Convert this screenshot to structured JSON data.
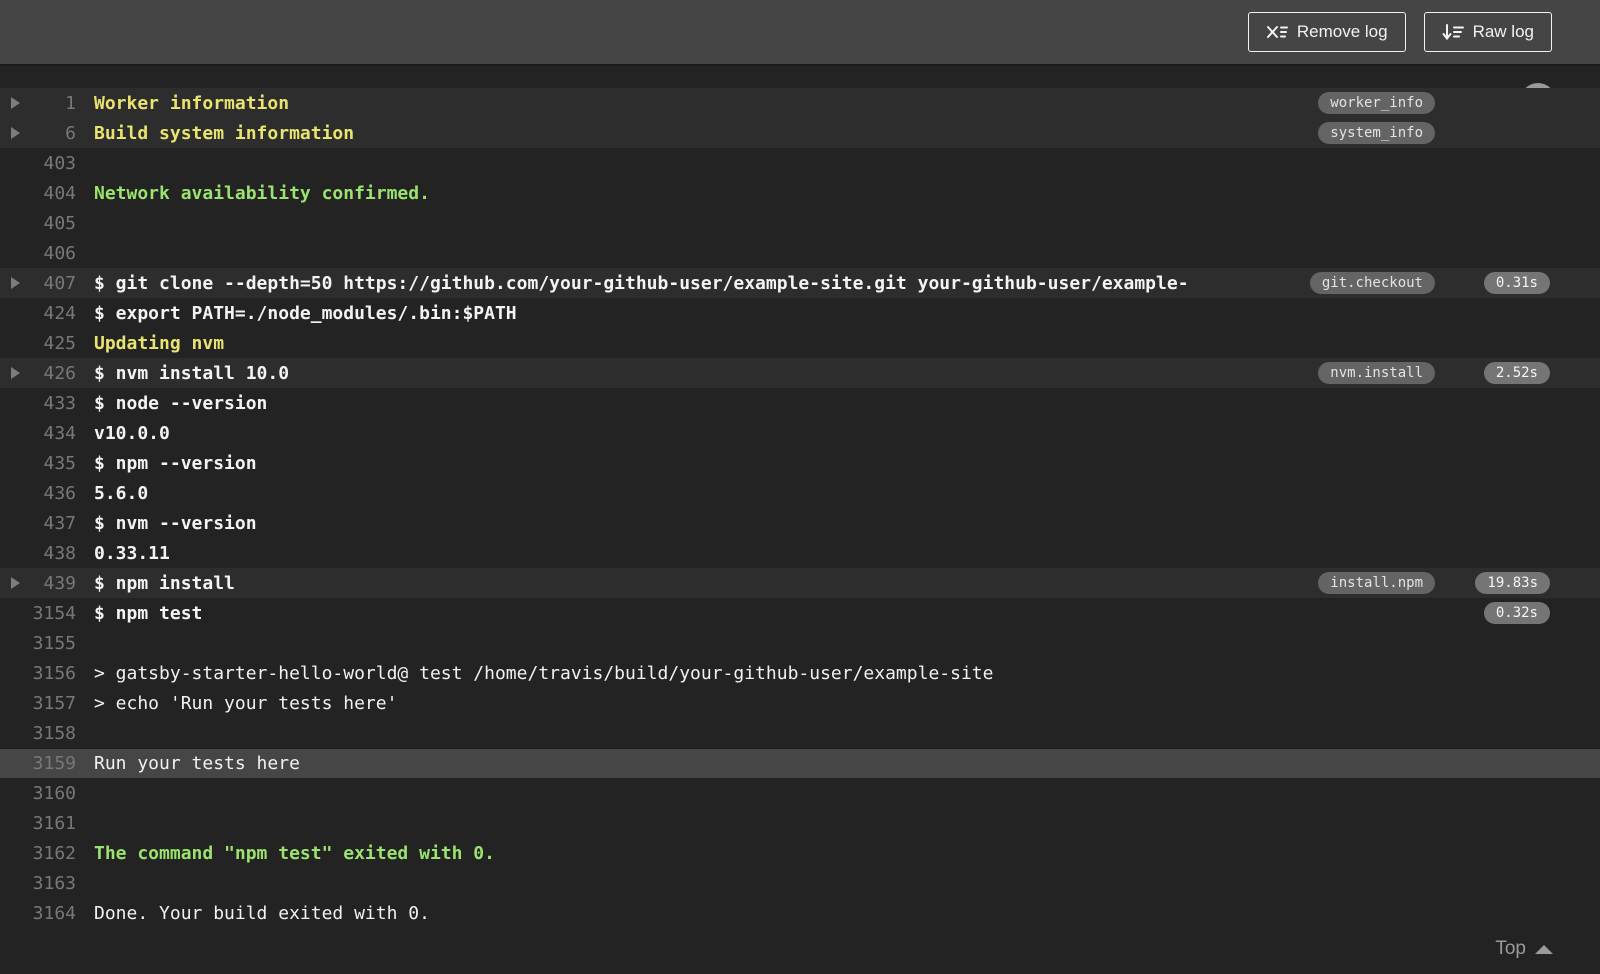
{
  "header": {
    "remove_log_label": "Remove log",
    "raw_log_label": "Raw log"
  },
  "colors": {
    "header_bg": "#454545",
    "log_bg": "#232323",
    "fold_row_bg": "#2d2d2d",
    "selected_row_bg": "#464646",
    "section_yellow": "#e9e370",
    "success_green": "#9be26e",
    "log_text": "#f1f1f1",
    "line_number": "#787878",
    "pill_bg": "#646464"
  },
  "log": {
    "rows": [
      {
        "num": "1",
        "text": "Worker information",
        "style": "section",
        "fold": true,
        "highlight": true,
        "tag": "worker_info"
      },
      {
        "num": "6",
        "text": "Build system information",
        "style": "section",
        "fold": true,
        "highlight": true,
        "tag": "system_info"
      },
      {
        "num": "403",
        "text": ""
      },
      {
        "num": "404",
        "text": "Network availability confirmed.",
        "style": "success"
      },
      {
        "num": "405",
        "text": ""
      },
      {
        "num": "406",
        "text": ""
      },
      {
        "num": "407",
        "text": "$ git clone --depth=50 https://github.com/your-github-user/example-site.git your-github-user/example-",
        "style": "command",
        "fold": true,
        "highlight": true,
        "tag": "git.checkout",
        "time": "0.31s"
      },
      {
        "num": "424",
        "text": "$ export PATH=./node_modules/.bin:$PATH",
        "style": "command"
      },
      {
        "num": "425",
        "text": "Updating nvm",
        "style": "section"
      },
      {
        "num": "426",
        "text": "$ nvm install 10.0",
        "style": "command",
        "fold": true,
        "highlight": true,
        "tag": "nvm.install",
        "time": "2.52s"
      },
      {
        "num": "433",
        "text": "$ node --version",
        "style": "command"
      },
      {
        "num": "434",
        "text": "v10.0.0",
        "style": "output-bold"
      },
      {
        "num": "435",
        "text": "$ npm --version",
        "style": "command"
      },
      {
        "num": "436",
        "text": "5.6.0",
        "style": "output-bold"
      },
      {
        "num": "437",
        "text": "$ nvm --version",
        "style": "command"
      },
      {
        "num": "438",
        "text": "0.33.11",
        "style": "output-bold"
      },
      {
        "num": "439",
        "text": "$ npm install",
        "style": "command",
        "fold": true,
        "highlight": true,
        "tag": "install.npm",
        "time": "19.83s"
      },
      {
        "num": "3154",
        "text": "$ npm test",
        "style": "command",
        "time": "0.32s"
      },
      {
        "num": "3155",
        "text": ""
      },
      {
        "num": "3156",
        "text": "> gatsby-starter-hello-world@ test /home/travis/build/your-github-user/example-site"
      },
      {
        "num": "3157",
        "text": "> echo 'Run your tests here'"
      },
      {
        "num": "3158",
        "text": ""
      },
      {
        "num": "3159",
        "text": "Run your tests here",
        "selected": true
      },
      {
        "num": "3160",
        "text": ""
      },
      {
        "num": "3161",
        "text": ""
      },
      {
        "num": "3162",
        "text": "The command \"npm test\" exited with 0.",
        "style": "success"
      },
      {
        "num": "3163",
        "text": ""
      },
      {
        "num": "3164",
        "text": "Done. Your build exited with 0."
      }
    ]
  },
  "footer": {
    "top_label": "Top"
  }
}
